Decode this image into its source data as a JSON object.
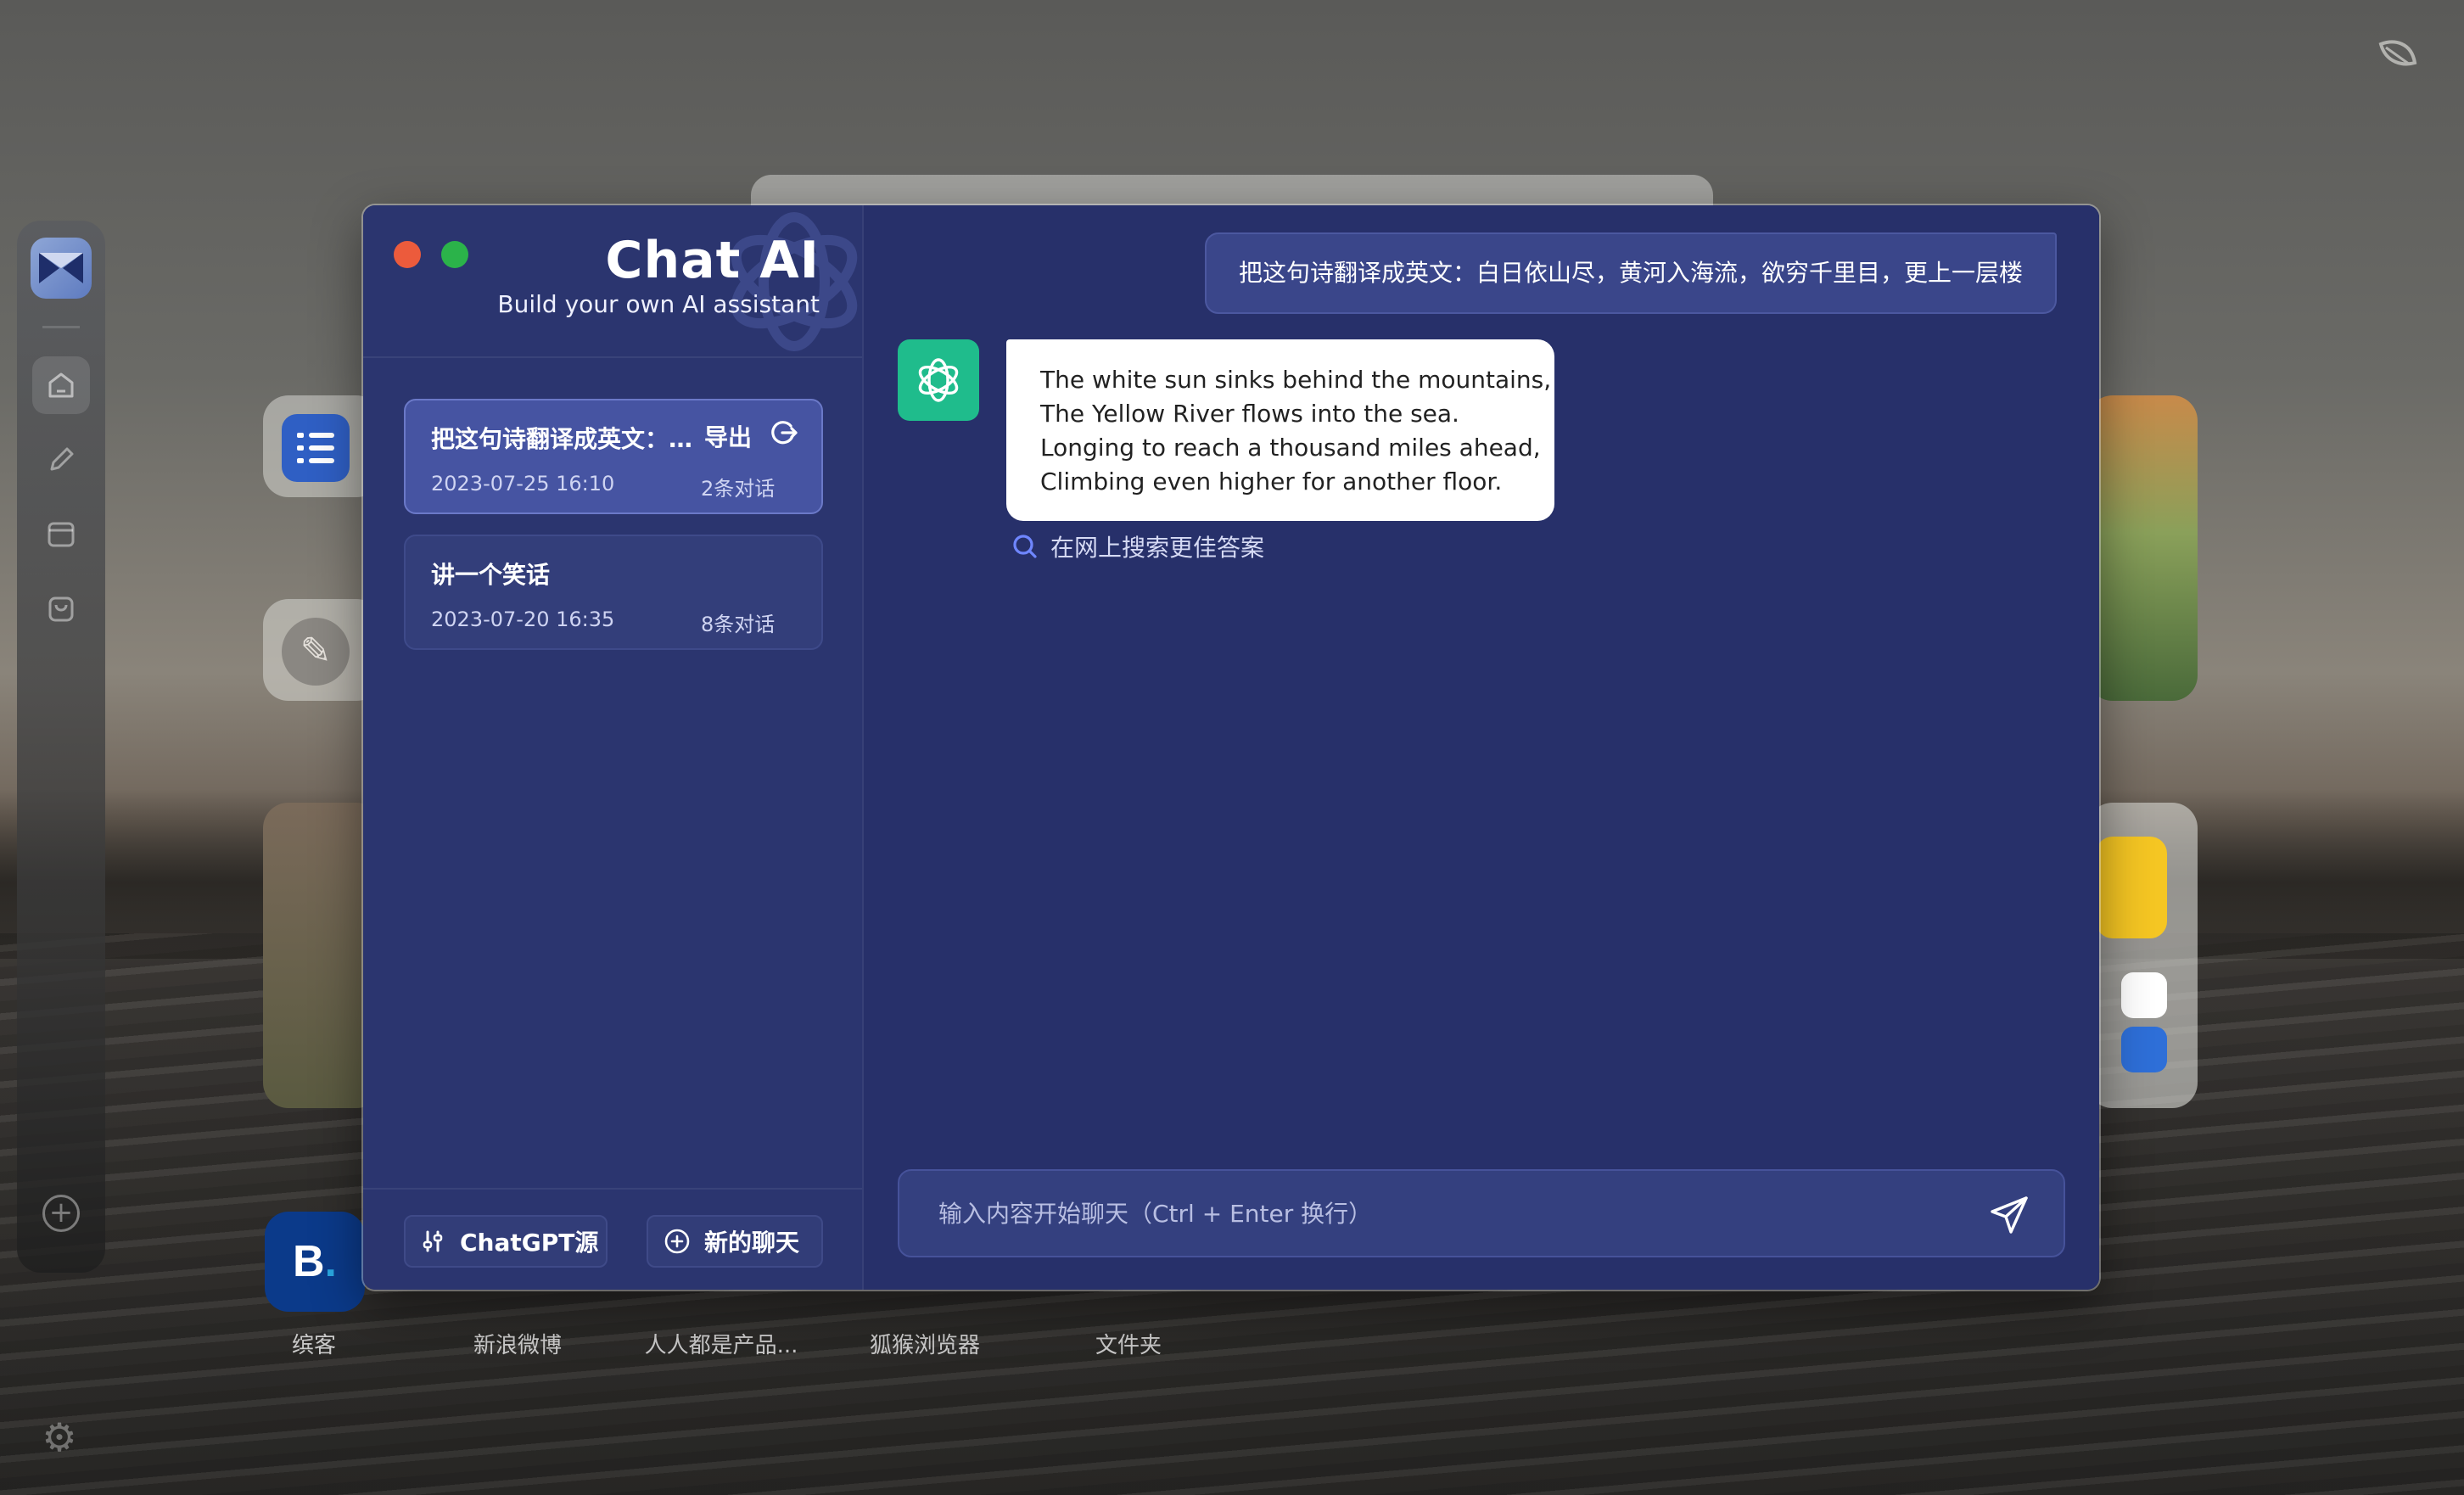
{
  "window": {
    "title": "Chat AI",
    "subtitle": "Build your own AI assistant"
  },
  "conversations": [
    {
      "title": "把这句诗翻译成英文：...",
      "date": "2023-07-25 16:10",
      "count": "2条对话",
      "export_label": "导出",
      "active": true
    },
    {
      "title": "讲一个笑话",
      "date": "2023-07-20 16:35",
      "count": "8条对话",
      "active": false
    }
  ],
  "footer": {
    "source_label": "ChatGPT源",
    "new_chat_label": "新的聊天"
  },
  "messages": {
    "user": "把这句诗翻译成英文：白日依山尽，黄河入海流，欲穷千里目，更上一层楼",
    "bot_lines": [
      "The white sun sinks behind the mountains,",
      "The Yellow River flows into the sea.",
      "Longing to reach a thousand miles ahead,",
      "Climbing even higher for another floor."
    ]
  },
  "search_link": "在网上搜索更佳答案",
  "input": {
    "placeholder": "输入内容开始聊天（Ctrl + Enter 换行）",
    "value": ""
  },
  "desktop": {
    "bottom_apps": [
      "缤客",
      "新浪微博",
      "人人都是产品...",
      "狐猴浏览器",
      "文件夹"
    ]
  },
  "colors": {
    "window_bg": "#27306a",
    "sidebar_bg": "#2b356f",
    "active_conv": "#4654a2",
    "bot_avatar": "#1fbc8c",
    "close": "#ec5b3c",
    "maximize": "#2bb34a"
  }
}
